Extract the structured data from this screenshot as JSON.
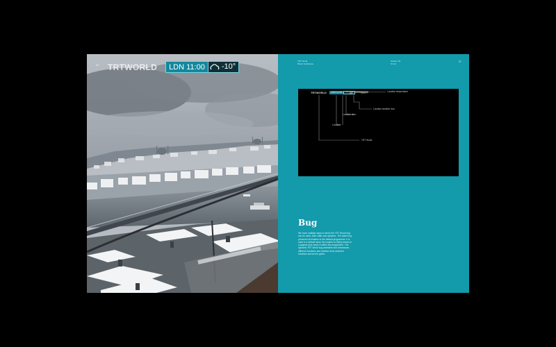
{
  "left_page": {
    "page_number": "86",
    "bug": {
      "logo": "TRTWORLD",
      "location_time": "LDN 11:00",
      "temperature": "-10°",
      "weather_icon": "cloud-icon"
    }
  },
  "right_page": {
    "header_left": [
      "TRT World",
      "Brand Guidelines"
    ],
    "header_right": [
      "Section 03",
      "On Air"
    ],
    "page_number": "87",
    "diagram": {
      "mini_bug": {
        "logo": "TRTWORLD",
        "location_time": "LDN 11:00",
        "temperature": "-10°"
      },
      "callouts": {
        "temperature": "Location temperature",
        "weather_icon": "Location weather icon",
        "time": "Location time",
        "location": "Location",
        "logo": "TRT World"
      }
    },
    "section_title": "Bug",
    "body": "We have multiple ways in which the TRT World bug can be used, both static and dynamic. The static bug presents information in the default programme. It is used in a default when the location is being shown in a graphic that needs it within the programme. The dynamic TRT World bug animates and showcases different locations and weather from selected locations across the globe."
  },
  "colors": {
    "accent": "#139aab",
    "bug_location_bg": "#12889e",
    "bug_weather_bg": "#0f2f37"
  }
}
